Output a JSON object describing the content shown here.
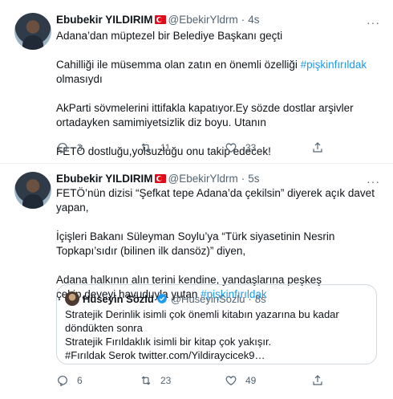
{
  "tweets": [
    {
      "name": "Ebubekir YILDIRIM",
      "handle": "@EbekirYldrm",
      "time": "4s",
      "paragraphs": [
        {
          "text": "Adana’dan müptezel bir Belediye Başkanı geçti",
          "link": ""
        },
        {
          "text": "Cahilliği ile müsemma olan zatın en önemli özelliği ",
          "link": "#pişkinfırıldak",
          "after": " olmasıydı"
        },
        {
          "text": "AkParti sövmelerini ittifakla kapatıyor.Ey sözde dostlar arşivler ortadayken samimiyetsizlik diz boyu. Utanın",
          "link": ""
        },
        {
          "text": "FETÖ dostluğu,yolsuzluğu onu takip edecek!",
          "link": ""
        }
      ],
      "stats": {
        "replies": "3",
        "retweets": "11",
        "likes": "33"
      }
    },
    {
      "name": "Ebubekir YILDIRIM",
      "handle": "@EbekirYldrm",
      "time": "5s",
      "paragraphs": [
        {
          "text": "FETÖ’nün dizisi  “Şefkat tepe Adana’da çekilsin” diyerek açık davet yapan,",
          "link": ""
        },
        {
          "text": "İçişleri Bakanı Süleyman Soylu’ya “Türk siyasetinin Nesrin Topkapı’sıdır (bilinen ilk dansöz)” diyen,",
          "link": ""
        },
        {
          "text": "Adana halkının alın terini kendine, yandaşlarına peşkeş çekip,deveyi havuduyla yutan ",
          "link": "#pişkinfırıldak",
          "after": ""
        }
      ],
      "quote": {
        "name": "Hüseyin Sözlü",
        "handle": "@HuseyinSozlu",
        "time": "8s",
        "lines": [
          "Stratejik Derinlik isimli çok önemli kitabın yazarına  bu kadar döndükten sonra",
          "Stratejik Fırıldaklık isimli bir kitap çok yakışır.",
          "#Fırıldak Serok twitter.com/Yildiraycicek9…"
        ]
      },
      "stats": {
        "replies": "6",
        "retweets": "23",
        "likes": "49"
      }
    }
  ],
  "colors": {
    "accent": "#1d9bf0",
    "muted": "#536471",
    "text": "#0f1419",
    "flag": "#e30a17"
  },
  "icons": {
    "reply": "reply-icon",
    "retweet": "retweet-icon",
    "like": "heart-icon",
    "share": "share-icon",
    "more": "more-icon",
    "verified": "verified-badge-icon"
  }
}
